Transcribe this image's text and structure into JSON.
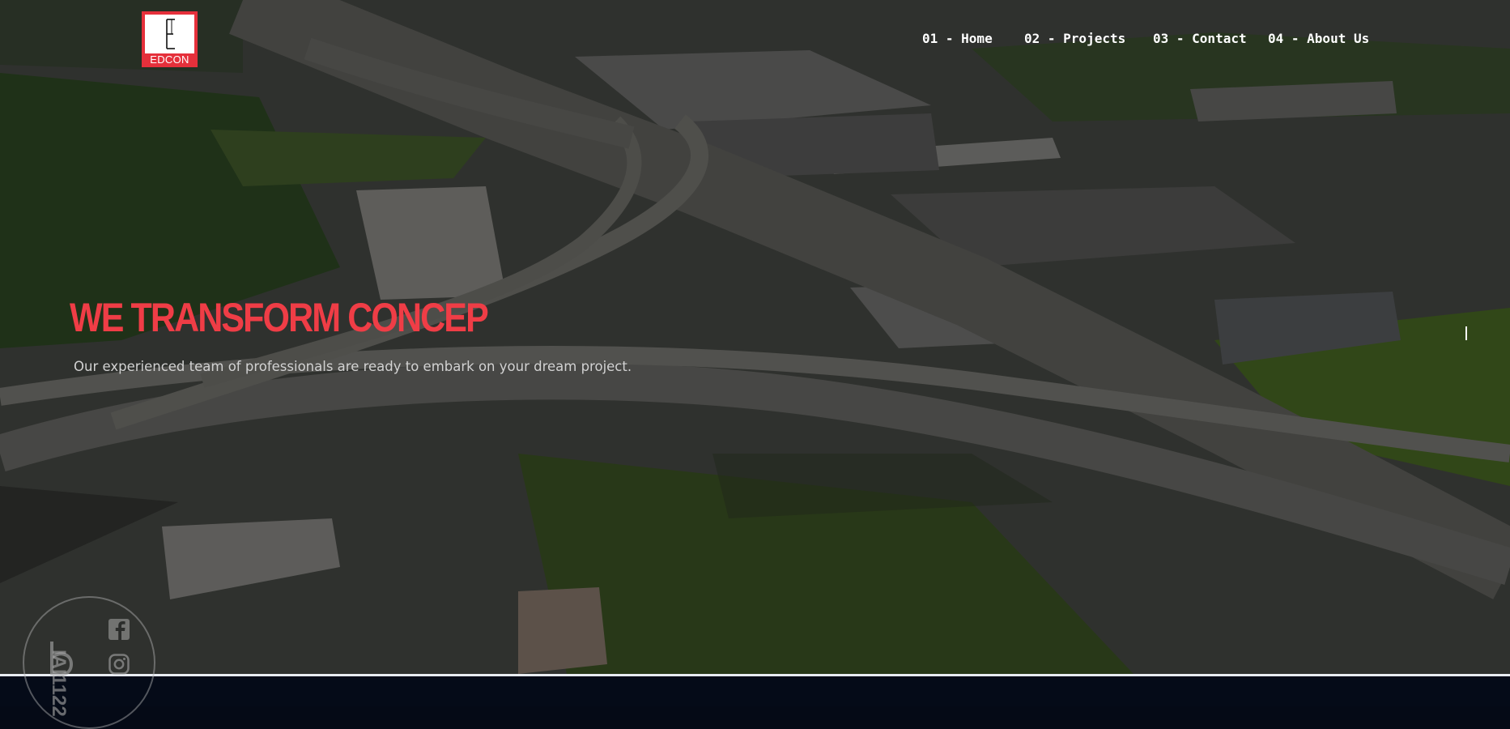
{
  "brand": {
    "name": "EDCON"
  },
  "nav": {
    "items": [
      {
        "label": "01 - Home"
      },
      {
        "label": "02 - Projects"
      },
      {
        "label": "03 - Contact"
      },
      {
        "label": "04 - About Us"
      }
    ]
  },
  "hero": {
    "headline": "WE TRANSFORM CONCEP",
    "subtitle": "Our experienced team of professionals are ready to embark on your dream project."
  },
  "watermark": {
    "handle": "IAI1122"
  },
  "colors": {
    "accent": "#ef3d46",
    "logo_red": "#e5303b",
    "footer_bg": "#050b18"
  }
}
